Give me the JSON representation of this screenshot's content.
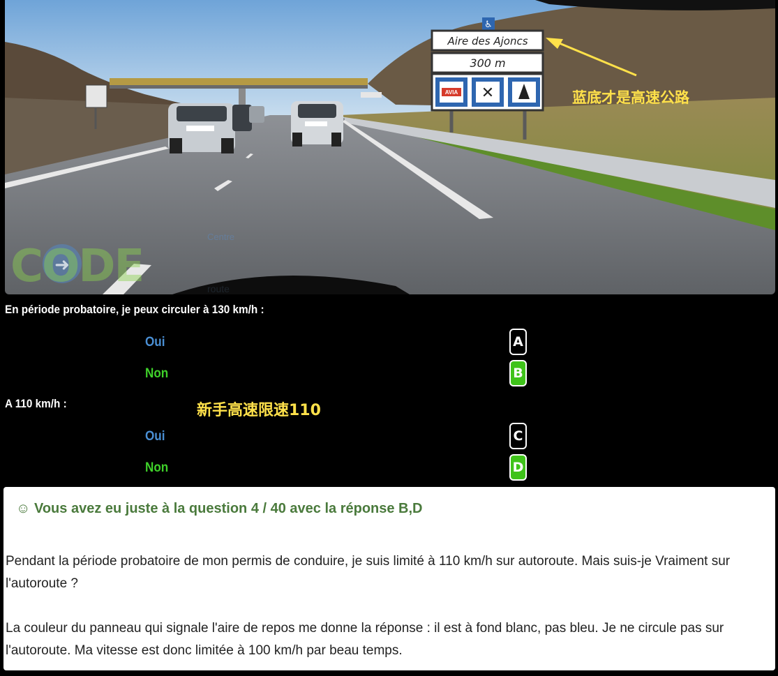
{
  "photo": {
    "sign_name": "Aire des Ajoncs",
    "sign_distance": "300 m",
    "sign_brand": "AVIA",
    "annotation_cn": "蓝底才是高速公路",
    "watermark_logo": "CODE",
    "watermark_small_1": "Centre",
    "watermark_small_2": "route"
  },
  "question1": {
    "label": "En période probatoire, je peux circuler à 130 km/h :",
    "options": [
      {
        "text": "Oui",
        "key": "A",
        "correct": false
      },
      {
        "text": "Non",
        "key": "B",
        "correct": true
      }
    ]
  },
  "question2": {
    "label": "A 110 km/h :",
    "annotation_cn": "新手高速限速110",
    "options": [
      {
        "text": "Oui",
        "key": "C",
        "correct": false
      },
      {
        "text": "Non",
        "key": "D",
        "correct": true
      }
    ]
  },
  "result": {
    "icon": "☺",
    "title": "Vous avez eu juste à la question 4 / 40 avec la réponse B,D",
    "paragraph1": "Pendant la période probatoire de mon permis de conduire, je suis limité à 110 km/h sur autoroute. Mais suis-je Vraiment sur l'autoroute ?",
    "paragraph2": "La couleur du panneau qui signale l'aire de repos me donne la réponse : il est à fond blanc, pas bleu. Je ne circule pas sur l'autoroute. Ma vitesse est donc limitée à 100 km/h par beau temps."
  },
  "colors": {
    "oui": "#4a8fd4",
    "non": "#3fd12a",
    "correct_key": "#3fc31a",
    "result_title": "#4a7a3c",
    "annotation": "#ffe14a"
  }
}
